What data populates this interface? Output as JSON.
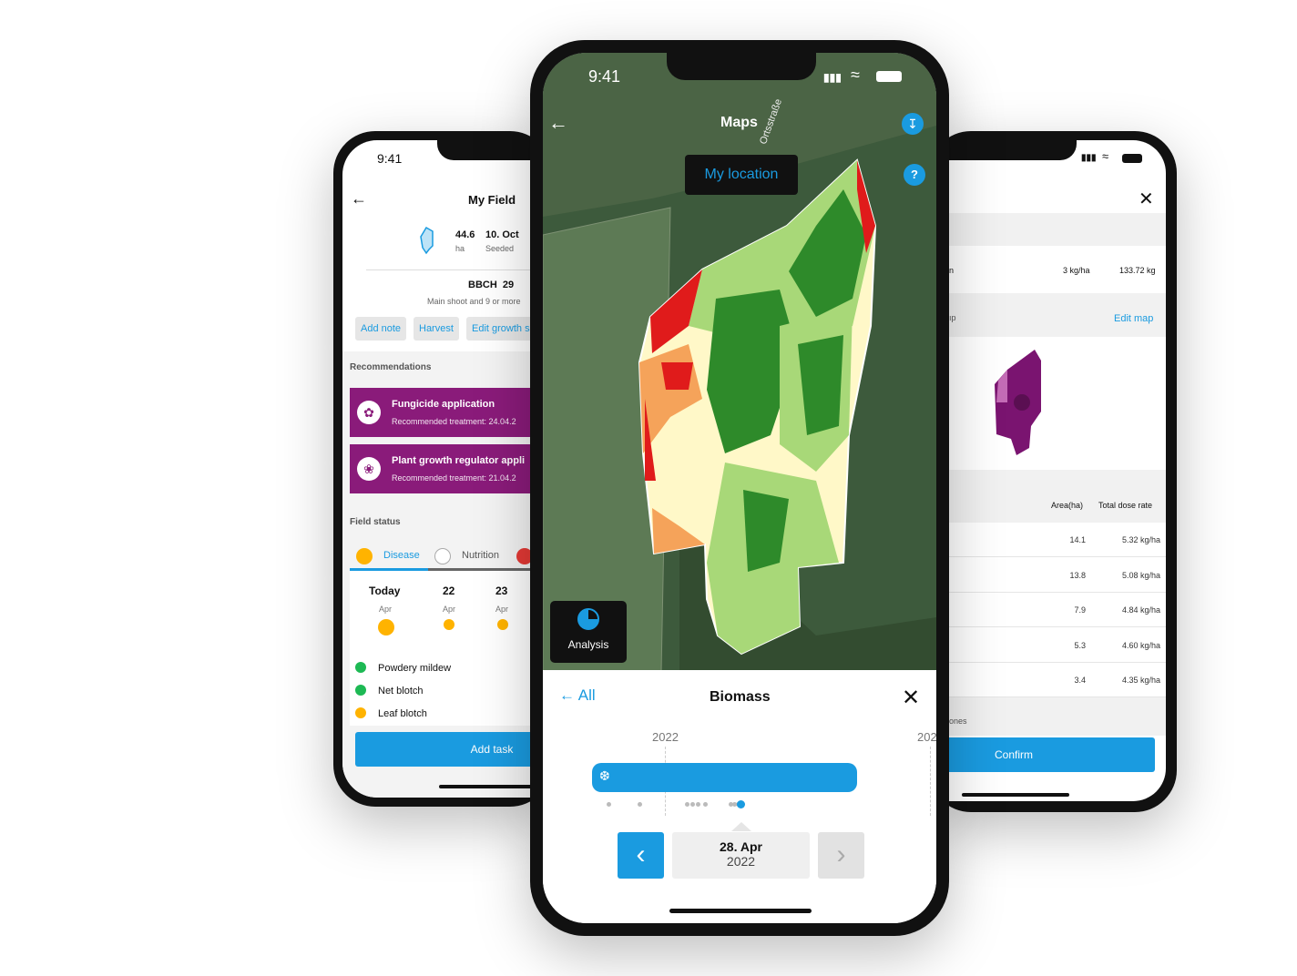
{
  "left_phone": {
    "time": "9:41",
    "title": "My Field",
    "area_value": "44.6",
    "area_unit": "ha",
    "seeded_value": "10. Oct",
    "seeded_label": "Seeded",
    "bbch": "BBCH  29",
    "bbch_desc": "Main shoot and 9 or more",
    "chips": [
      "Add note",
      "Harvest",
      "Edit growth s"
    ],
    "recommendations_label": "Recommendations",
    "recommendations": [
      {
        "title": "Fungicide application",
        "subtitle": "Recommended treatment: 24.04.2"
      },
      {
        "title": "Plant growth regulator appli",
        "subtitle": "Recommended treatment: 21.04.2"
      }
    ],
    "field_status_label": "Field status",
    "tabs": [
      "Disease",
      "Nutrition"
    ],
    "days": [
      {
        "day": "Today",
        "month": "Apr"
      },
      {
        "day": "22",
        "month": "Apr"
      },
      {
        "day": "23",
        "month": "Apr"
      }
    ],
    "diseases": [
      {
        "name": "Powdery mildew",
        "color": "#1db954"
      },
      {
        "name": "Net blotch",
        "color": "#1db954"
      },
      {
        "name": "Leaf blotch",
        "color": "#ffb300"
      }
    ],
    "add_task": "Add task"
  },
  "center_phone": {
    "time": "9:41",
    "title": "Maps",
    "street": "Ortsstraße",
    "my_location": "My location",
    "analysis": "Analysis",
    "back_all": "All",
    "panel_title": "Biomass",
    "year_left": "2022",
    "year_right": "202",
    "selected_date_day": "28. Apr",
    "selected_date_year": "2022"
  },
  "right_phone": {
    "row_partial": "n",
    "rate": "3 kg/ha",
    "total": "133.72 kg",
    "map_partial": "ıp",
    "edit_map": "Edit map",
    "col_area": "Area(ha)",
    "col_dose": "Total dose rate",
    "zones": [
      {
        "area": "14.1",
        "dose": "5.32 kg/ha"
      },
      {
        "area": "13.8",
        "dose": "5.08 kg/ha"
      },
      {
        "area": "7.9",
        "dose": "4.84 kg/ha"
      },
      {
        "area": "5.3",
        "dose": "4.60 kg/ha"
      },
      {
        "area": "3.4",
        "dose": "4.35 kg/ha"
      }
    ],
    "zones_partial": "ones",
    "confirm": "Confirm"
  },
  "colors": {
    "accent": "#1a9be0",
    "recommendation": "#8a1b7a",
    "warning": "#ffb300",
    "ok": "#1db954"
  }
}
